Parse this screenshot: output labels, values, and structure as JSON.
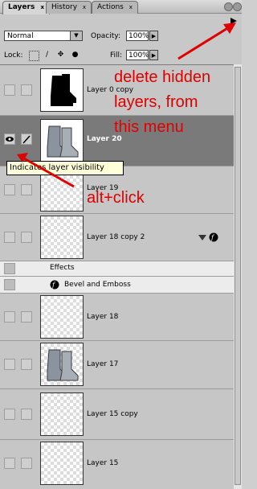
{
  "tabs": [
    {
      "label": "Layers",
      "active": true
    },
    {
      "label": "History",
      "active": false
    },
    {
      "label": "Actions",
      "active": false
    }
  ],
  "tab_close_glyph": "x",
  "blend_mode": "Normal",
  "opacity": {
    "label": "Opacity:",
    "value": "100%"
  },
  "lock": {
    "label": "Lock:"
  },
  "fill": {
    "label": "Fill:",
    "value": "100%"
  },
  "layers": [
    {
      "name": "Layer 0 copy",
      "thumb": "boot-black"
    },
    {
      "name": "Layer 20",
      "thumb": "boots-grey",
      "selected": true,
      "visible": true
    },
    {
      "name": "Layer 19",
      "thumb": "empty"
    },
    {
      "name": "Layer 18 copy 2",
      "thumb": "empty"
    },
    {
      "name": "Layer 18",
      "thumb": "empty"
    },
    {
      "name": "Layer 17",
      "thumb": "boots-grey"
    },
    {
      "name": "Layer 15 copy",
      "thumb": "empty"
    },
    {
      "name": "Layer 15",
      "thumb": "empty"
    }
  ],
  "effects": {
    "label": "Effects",
    "item": "Bevel and Emboss"
  },
  "tooltip": "Indicates layer visibility",
  "annotations": {
    "delete": "delete hidden layers, from this menu",
    "delete_line1": "delete hidden",
    "delete_line2": "layers, from",
    "delete_line3": "this menu",
    "altclick": "alt+click"
  },
  "colors": {
    "annotation": "#e00000",
    "selected_row": "#7a7a7a",
    "tooltip_bg": "#ffffd9"
  }
}
